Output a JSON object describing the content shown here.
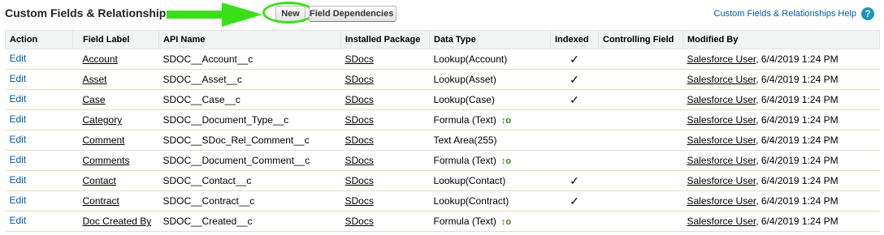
{
  "header": {
    "title": "Custom Fields & Relationships",
    "new_button": "New",
    "field_dependencies_button": "Field Dependencies",
    "help_link": "Custom Fields & Relationships Help",
    "help_icon": "?"
  },
  "table": {
    "columns": [
      "Action",
      "Field Label",
      "API Name",
      "Installed Package",
      "Data Type",
      "Indexed",
      "Controlling Field",
      "Modified By"
    ],
    "rows": [
      {
        "action": "Edit",
        "label": "Account",
        "api": "SDOC__Account__c",
        "package": "SDocs",
        "type": "Lookup(Account)",
        "indexed": "✓",
        "formula": false,
        "user": "Salesforce User",
        "date": ", 6/4/2019 1:24 PM"
      },
      {
        "action": "Edit",
        "label": "Asset",
        "api": "SDOC__Asset__c",
        "package": "SDocs",
        "type": "Lookup(Asset)",
        "indexed": "✓",
        "formula": false,
        "user": "Salesforce User",
        "date": ", 6/4/2019 1:24 PM"
      },
      {
        "action": "Edit",
        "label": "Case",
        "api": "SDOC__Case__c",
        "package": "SDocs",
        "type": "Lookup(Case)",
        "indexed": "✓",
        "formula": false,
        "user": "Salesforce User",
        "date": ", 6/4/2019 1:24 PM"
      },
      {
        "action": "Edit",
        "label": "Category",
        "api": "SDOC__Document_Type__c",
        "package": "SDocs",
        "type": "Formula (Text)",
        "indexed": "",
        "formula": true,
        "user": "Salesforce User",
        "date": ", 6/4/2019 1:24 PM"
      },
      {
        "action": "Edit",
        "label": "Comment",
        "api": "SDOC__SDoc_Rel_Comment__c",
        "package": "SDocs",
        "type": "Text Area(255)",
        "indexed": "",
        "formula": false,
        "user": "Salesforce User",
        "date": ", 6/4/2019 1:24 PM"
      },
      {
        "action": "Edit",
        "label": "Comments",
        "api": "SDOC__Document_Comment__c",
        "package": "SDocs",
        "type": "Formula (Text)",
        "indexed": "",
        "formula": true,
        "user": "Salesforce User",
        "date": ", 6/4/2019 1:24 PM"
      },
      {
        "action": "Edit",
        "label": "Contact",
        "api": "SDOC__Contact__c",
        "package": "SDocs",
        "type": "Lookup(Contact)",
        "indexed": "✓",
        "formula": false,
        "user": "Salesforce User",
        "date": ", 6/4/2019 1:24 PM"
      },
      {
        "action": "Edit",
        "label": "Contract",
        "api": "SDOC__Contract__c",
        "package": "SDocs",
        "type": "Lookup(Contract)",
        "indexed": "✓",
        "formula": false,
        "user": "Salesforce User",
        "date": ", 6/4/2019 1:24 PM"
      },
      {
        "action": "Edit",
        "label": "Doc Created By",
        "api": "SDOC__Created__c",
        "package": "SDocs",
        "type": "Formula (Text)",
        "indexed": "",
        "formula": true,
        "user": "Salesforce User",
        "date": ", 6/4/2019 1:24 PM"
      }
    ]
  },
  "colors": {
    "arrow": "#39e01a",
    "link": "#015ba7",
    "header_bg": "#f2f3f3"
  }
}
